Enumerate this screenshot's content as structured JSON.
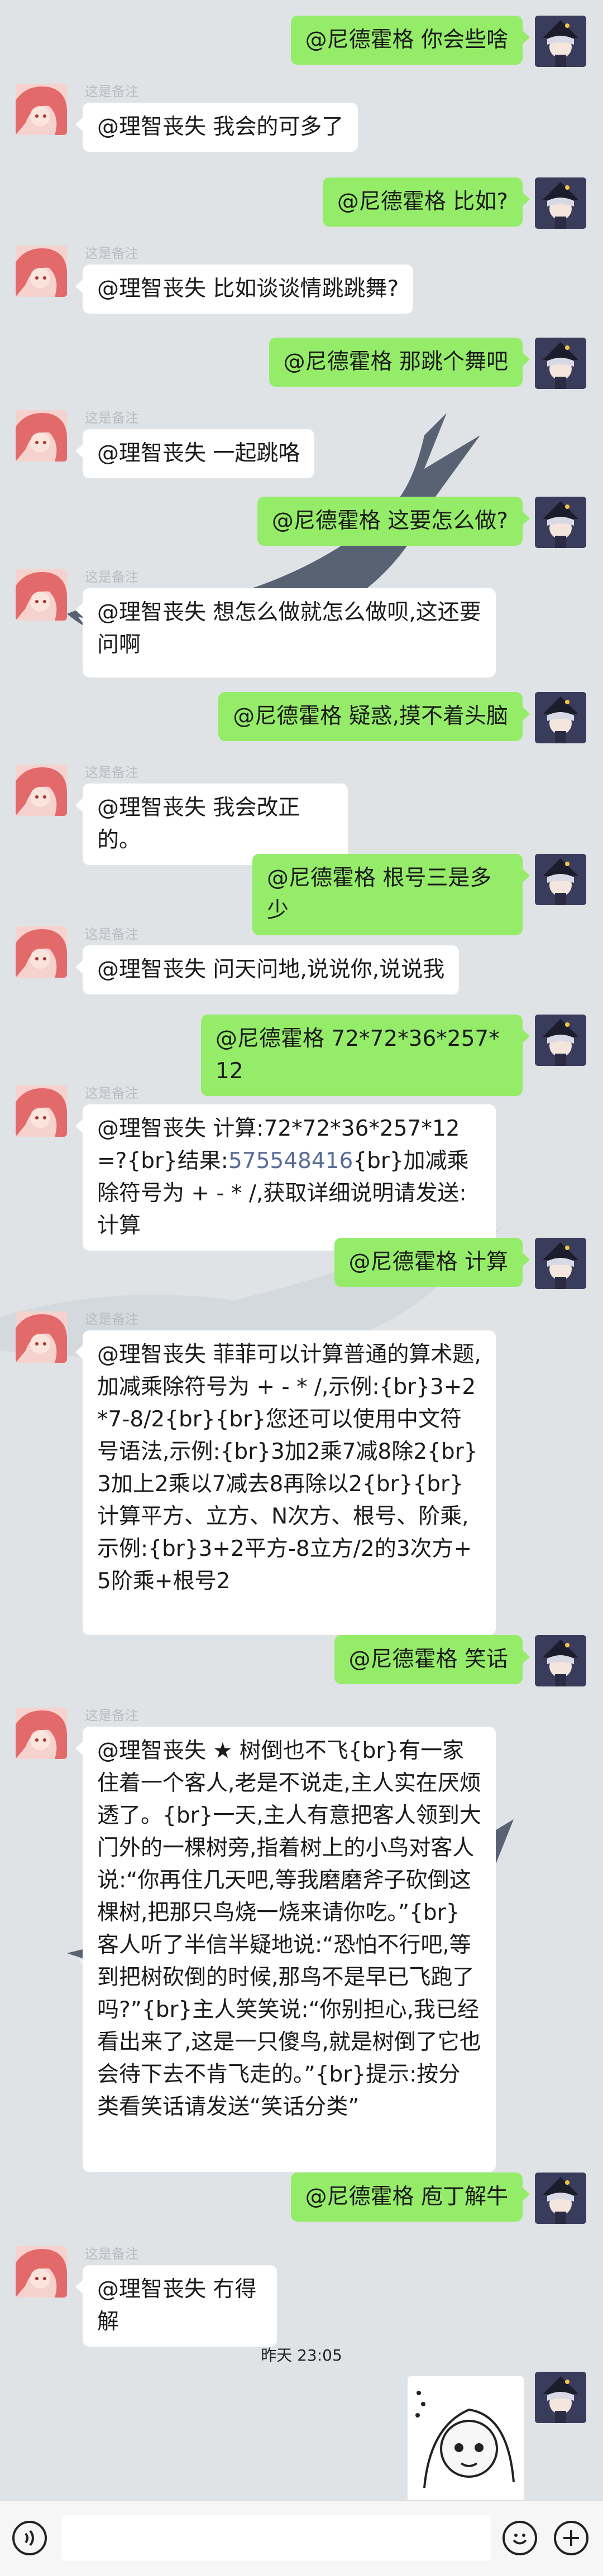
{
  "chat": {
    "bot_nickname": "这是备注",
    "messages": [
      {
        "side": "out",
        "text": "@尼德霍格  你会些啥"
      },
      {
        "side": "in",
        "text": "@理智丧失 我会的可多了"
      },
      {
        "side": "out",
        "text": "@尼德霍格  比如?"
      },
      {
        "side": "in",
        "text": "@理智丧失 比如谈谈情跳跳舞?"
      },
      {
        "side": "out",
        "text": "@尼德霍格  那跳个舞吧"
      },
      {
        "side": "in",
        "text": "@理智丧失 一起跳咯"
      },
      {
        "side": "out",
        "text": "@尼德霍格  这要怎么做?"
      },
      {
        "side": "in",
        "text": "@理智丧失 想怎么做就怎么做呗,这还要问啊"
      },
      {
        "side": "out",
        "text": "@尼德霍格  疑惑,摸不着头脑"
      },
      {
        "side": "in",
        "text": "@理智丧失 我会改正的。"
      },
      {
        "side": "out",
        "text": "@尼德霍格  根号三是多少"
      },
      {
        "side": "in",
        "text": "@理智丧失 问天问地,说说你,说说我"
      },
      {
        "side": "out",
        "text": "@尼德霍格  72*72*36*257*12"
      },
      {
        "side": "in",
        "text": "@理智丧失 计算:72*72*36*257*12=?{br}结果:575548416{br}加减乘除符号为 + - * /,获取详细说明请发送:计算"
      },
      {
        "side": "out",
        "text": "@尼德霍格  计算"
      },
      {
        "side": "in",
        "text": "@理智丧失 菲菲可以计算普通的算术题,加减乘除符号为 + - * /,示例:{br}3+2*7-8/2{br}{br}您还可以使用中文符号语法,示例:{br}3加2乘7减8除2{br}3加上2乘以7减去8再除以2{br}{br}计算平方、立方、N次方、根号、阶乘,示例:{br}3+2平方-8立方/2的3次方+5阶乘+根号2"
      },
      {
        "side": "out",
        "text": "@尼德霍格  笑话"
      },
      {
        "side": "in",
        "text": "@理智丧失 ★ 树倒也不飞{br}有一家住着一个客人,老是不说走,主人实在厌烦透了。{br}一天,主人有意把客人领到大门外的一棵树旁,指着树上的小鸟对客人说:“你再住几天吧,等我磨磨斧子砍倒这棵树,把那只鸟烧一烧来请你吃。”{br}客人听了半信半疑地说:“恐怕不行吧,等到把树砍倒的时候,那鸟不是早已飞跑了吗?”{br}主人笑笑说:“你别担心,我已经看出来了,这是一只傻鸟,就是树倒了它也会待下去不肯飞走的。”{br}提示:按分类看笑话请发送“笑话分类”"
      },
      {
        "side": "out",
        "text": "@尼德霍格  庖丁解牛"
      },
      {
        "side": "in",
        "text": "@理智丧失 冇得解"
      }
    ],
    "timestamp": "昨天 23:05",
    "sticker": "sticker-image"
  },
  "colors": {
    "outgoing": "#95ec69",
    "incoming": "#ffffff",
    "background": "#dfe3e6",
    "link": "#576b95"
  },
  "icons": {
    "voice": "voice-icon",
    "emoji": "emoji-icon",
    "plus": "plus-icon"
  }
}
